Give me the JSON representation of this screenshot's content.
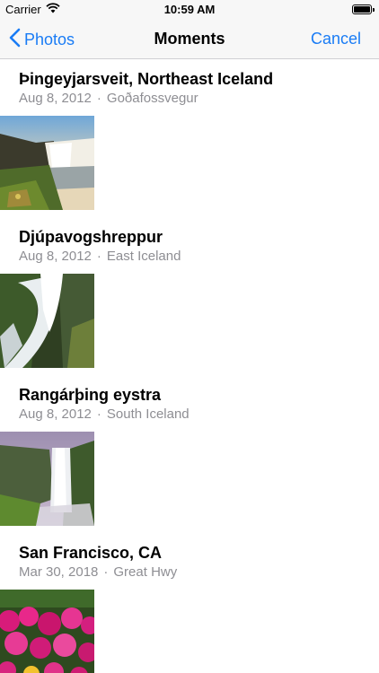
{
  "status_bar": {
    "carrier": "Carrier",
    "time": "10:59 AM",
    "icons": [
      "wifi-icon",
      "battery-icon"
    ]
  },
  "nav": {
    "back_label": "Photos",
    "title": "Moments",
    "cancel_label": "Cancel",
    "accent_color": "#1a7cf5"
  },
  "moments": [
    {
      "title": "Þingeyjarsveit, Northeast Iceland",
      "date": "Aug 8, 2012",
      "separator": "·",
      "place": "Goðafossvegur",
      "photo": "waterfall-sunset-photo"
    },
    {
      "title": "Djúpavogshreppur",
      "date": "Aug 8, 2012",
      "separator": "·",
      "place": "East Iceland",
      "photo": "waterfall-closeup-photo"
    },
    {
      "title": "Rangárþing eystra",
      "date": "Aug 8, 2012",
      "separator": "·",
      "place": "South Iceland",
      "photo": "tall-waterfall-photo"
    },
    {
      "title": "San Francisco, CA",
      "date": "Mar 30, 2018",
      "separator": "·",
      "place": "Great Hwy",
      "photo": "flowers-photo"
    }
  ]
}
